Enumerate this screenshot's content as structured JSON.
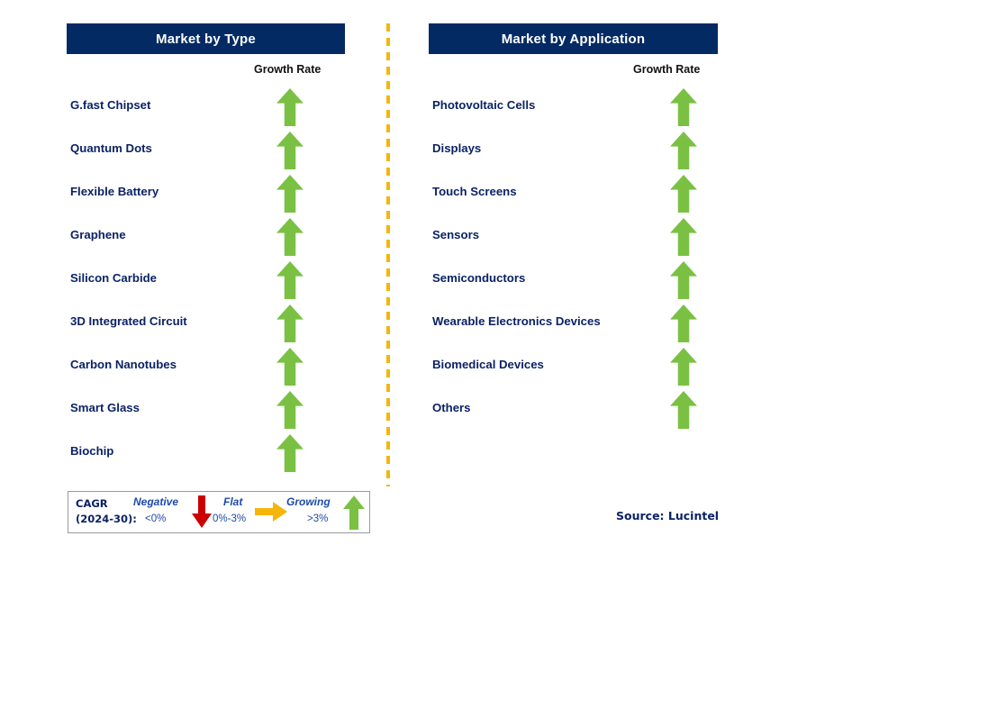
{
  "panels": [
    {
      "id": "type",
      "title": "Market by Type",
      "growth_rate_label": "Growth Rate",
      "rows": [
        {
          "label": "G.fast Chipset",
          "trend": "growing",
          "icon": "arrow-up-icon"
        },
        {
          "label": "Quantum Dots",
          "trend": "growing",
          "icon": "arrow-up-icon"
        },
        {
          "label": "Flexible Battery",
          "trend": "growing",
          "icon": "arrow-up-icon"
        },
        {
          "label": "Graphene",
          "trend": "growing",
          "icon": "arrow-up-icon"
        },
        {
          "label": "Silicon Carbide",
          "trend": "growing",
          "icon": "arrow-up-icon"
        },
        {
          "label": "3D Integrated Circuit",
          "trend": "growing",
          "icon": "arrow-up-icon"
        },
        {
          "label": "Carbon Nanotubes",
          "trend": "growing",
          "icon": "arrow-up-icon"
        },
        {
          "label": "Smart Glass",
          "trend": "growing",
          "icon": "arrow-up-icon"
        },
        {
          "label": "Biochip",
          "trend": "growing",
          "icon": "arrow-up-icon"
        }
      ]
    },
    {
      "id": "application",
      "title": "Market by Application",
      "growth_rate_label": "Growth Rate",
      "rows": [
        {
          "label": "Photovoltaic Cells",
          "trend": "growing",
          "icon": "arrow-up-icon"
        },
        {
          "label": "Displays",
          "trend": "growing",
          "icon": "arrow-up-icon"
        },
        {
          "label": "Touch Screens",
          "trend": "growing",
          "icon": "arrow-up-icon"
        },
        {
          "label": "Sensors",
          "trend": "growing",
          "icon": "arrow-up-icon"
        },
        {
          "label": "Semiconductors",
          "trend": "growing",
          "icon": "arrow-up-icon"
        },
        {
          "label": "Wearable Electronics Devices",
          "trend": "growing",
          "icon": "arrow-up-icon"
        },
        {
          "label": "Biomedical Devices",
          "trend": "growing",
          "icon": "arrow-up-icon"
        },
        {
          "label": "Others",
          "trend": "growing",
          "icon": "arrow-up-icon"
        }
      ]
    }
  ],
  "legend": {
    "title_line1": "CAGR",
    "title_line2": "(2024-30):",
    "items": [
      {
        "term": "Negative",
        "range": "<0%",
        "icon": "arrow-down-icon",
        "color": "#cc0000"
      },
      {
        "term": "Flat",
        "range": "0%-3%",
        "icon": "arrow-right-icon",
        "color": "#f5b50a"
      },
      {
        "term": "Growing",
        "range": ">3%",
        "icon": "arrow-up-icon",
        "color": "#7ac143"
      }
    ]
  },
  "source": "Source: Lucintel",
  "colors": {
    "header_navy": "#042a63",
    "label_navy": "#0b2265",
    "growing_green": "#7ac143",
    "negative_red": "#cc0000",
    "flat_orange": "#f5b50a",
    "divider_orange": "#f5b50a"
  }
}
